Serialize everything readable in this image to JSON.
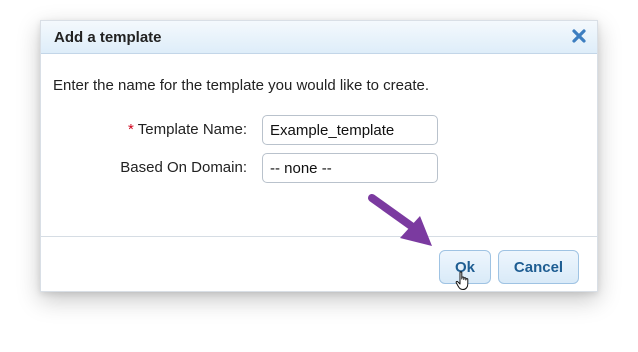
{
  "dialog": {
    "title": "Add a template",
    "intro": "Enter the name for the template you would like to create.",
    "fields": {
      "template_name": {
        "required_marker": "*",
        "label": "Template Name:",
        "value": "Example_template"
      },
      "based_on_domain": {
        "label": "Based On Domain:",
        "value": "-- none --"
      }
    },
    "buttons": {
      "ok": "Ok",
      "cancel": "Cancel"
    }
  },
  "icons": {
    "close": "close-icon",
    "annotation": "arrow-annotation-icon",
    "pointer": "hand-pointer-cursor-icon"
  },
  "colors": {
    "accent": "#1e5d92",
    "annotation": "#7b3aa0",
    "required": "#d0021b"
  }
}
